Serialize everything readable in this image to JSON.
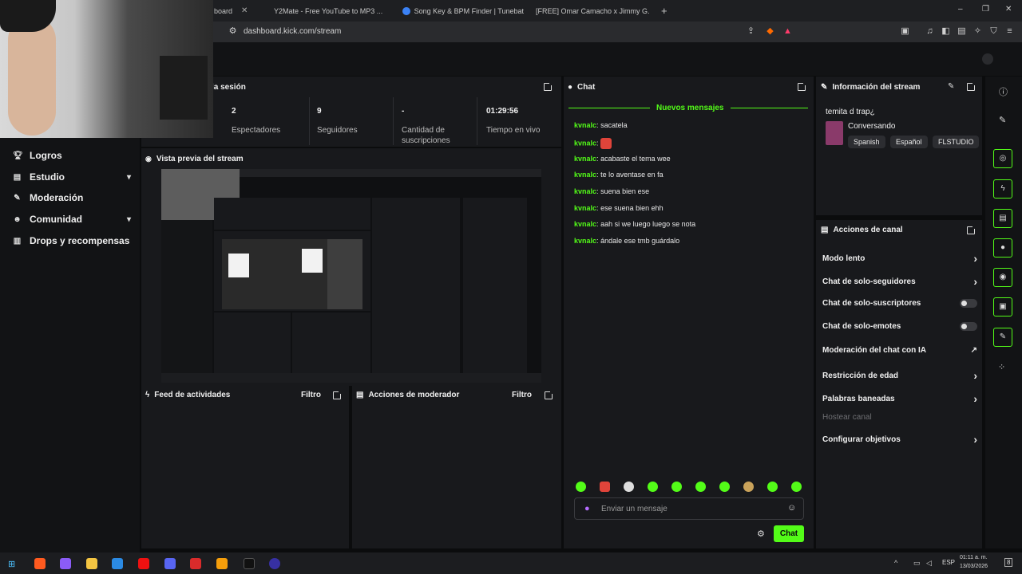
{
  "browser": {
    "tabs": [
      {
        "label": "board",
        "active": true
      },
      {
        "label": "Y2Mate - Free YouTube to MP3 ..."
      },
      {
        "label": "Song Key & BPM Finder | Tunebat"
      },
      {
        "label": "[FREE] Omar Camacho x Jimmy G..."
      }
    ],
    "new_tab": "+",
    "url": "dashboard.kick.com/stream",
    "window_controls": [
      "–",
      "❐",
      "✕"
    ]
  },
  "sidebar": {
    "items": [
      {
        "label": "Logros",
        "icon": "trophy-icon",
        "has_chevron": false
      },
      {
        "label": "Estudio",
        "icon": "video-icon",
        "has_chevron": true
      },
      {
        "label": "Moderación",
        "icon": "wrench-icon",
        "has_chevron": false
      },
      {
        "label": "Comunidad",
        "icon": "people-icon",
        "has_chevron": true
      },
      {
        "label": "Drops y recompensas",
        "icon": "gift-icon",
        "has_chevron": false
      }
    ]
  },
  "session": {
    "title": "la sesión",
    "stats": [
      {
        "value": "2",
        "label": "Espectadores"
      },
      {
        "value": "9",
        "label": "Seguidores"
      },
      {
        "value": "-",
        "label": "Cantidad de suscripciones"
      },
      {
        "value": "01:29:56",
        "label": "Tiempo en vivo"
      }
    ]
  },
  "preview": {
    "title": "Vista previa del stream"
  },
  "activity_feed": {
    "title": "Feed de actividades",
    "filter": "Filtro"
  },
  "mod_actions": {
    "title": "Acciones de moderador",
    "filter": "Filtro"
  },
  "chat": {
    "title": "Chat",
    "new_messages": "Nuevos mensajes",
    "messages": [
      {
        "user": "kvnalc",
        "text": "sacatela"
      },
      {
        "user": "kvnalc",
        "text": ""
      },
      {
        "user": "kvnalc",
        "text": "acabaste el tema wee"
      },
      {
        "user": "kvnalc",
        "text": "te lo aventase en fa"
      },
      {
        "user": "kvnalc",
        "text": "suena bien ese"
      },
      {
        "user": "kvnalc",
        "text": "ese suena bien ehh"
      },
      {
        "user": "kvnalc",
        "text": "aah si we luego luego se nota"
      },
      {
        "user": "kvnalc",
        "text": "ándale ese tmb guárdalo"
      }
    ],
    "separator": ":",
    "input_placeholder": "Enviar un mensaje",
    "send_button": "Chat",
    "accent": "#53fc18"
  },
  "stream_info": {
    "title": "Información del stream",
    "stream_title": "temita d trap¿",
    "category": "Conversando",
    "tags": [
      "Spanish",
      "Español",
      "FLSTUDIO"
    ]
  },
  "channel_actions": {
    "title": "Acciones de canal",
    "items": [
      {
        "label": "Modo lento",
        "control": "chevron"
      },
      {
        "label": "Chat de solo-seguidores",
        "control": "chevron"
      },
      {
        "label": "Chat de solo-suscriptores",
        "control": "toggle"
      },
      {
        "label": "Chat de solo-emotes",
        "control": "toggle"
      },
      {
        "label": "Moderación del chat con IA",
        "control": "external"
      },
      {
        "label": "Restricción de edad",
        "control": "chevron"
      },
      {
        "label": "Palabras baneadas",
        "control": "chevron"
      },
      {
        "label": "Hostear canal",
        "control": "none",
        "disabled": true
      },
      {
        "label": "Configurar objetivos",
        "control": "chevron"
      }
    ]
  },
  "taskbar": {
    "language": "ESP",
    "time": "01:11 a. m.",
    "date": "13/03/2026",
    "notifications": "8"
  }
}
